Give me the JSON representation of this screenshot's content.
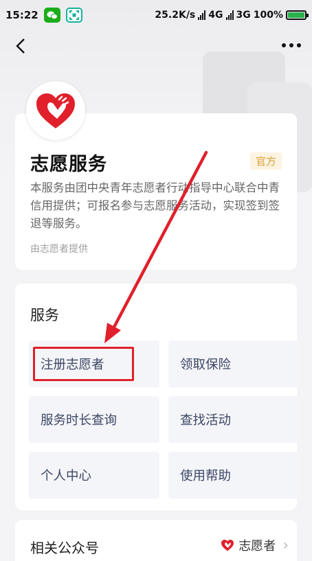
{
  "status_bar": {
    "time": "15:22",
    "net_speed": "25.2K/s",
    "net1": "4G",
    "net2": "3G",
    "battery": "100%",
    "battery_level": 1.0
  },
  "service": {
    "name": "志愿服务",
    "badge": "官方",
    "description": "本服务由团中央青年志愿者行动指导中心联合中青信用提供；可报名参与志愿服务活动，实现签到签退等服务。",
    "provider": "由志愿者提供"
  },
  "services_section": {
    "title": "服务",
    "items": [
      {
        "label": "注册志愿者"
      },
      {
        "label": "领取保险"
      },
      {
        "label": "服务时长查询"
      },
      {
        "label": "查找活动"
      },
      {
        "label": "个人中心"
      },
      {
        "label": "使用帮助"
      }
    ]
  },
  "related": {
    "title": "相关公众号",
    "account": "志愿者"
  },
  "colors": {
    "brand_red": "#e0202b",
    "badge_text": "#d9a23a",
    "tile_text": "#3c4766"
  }
}
